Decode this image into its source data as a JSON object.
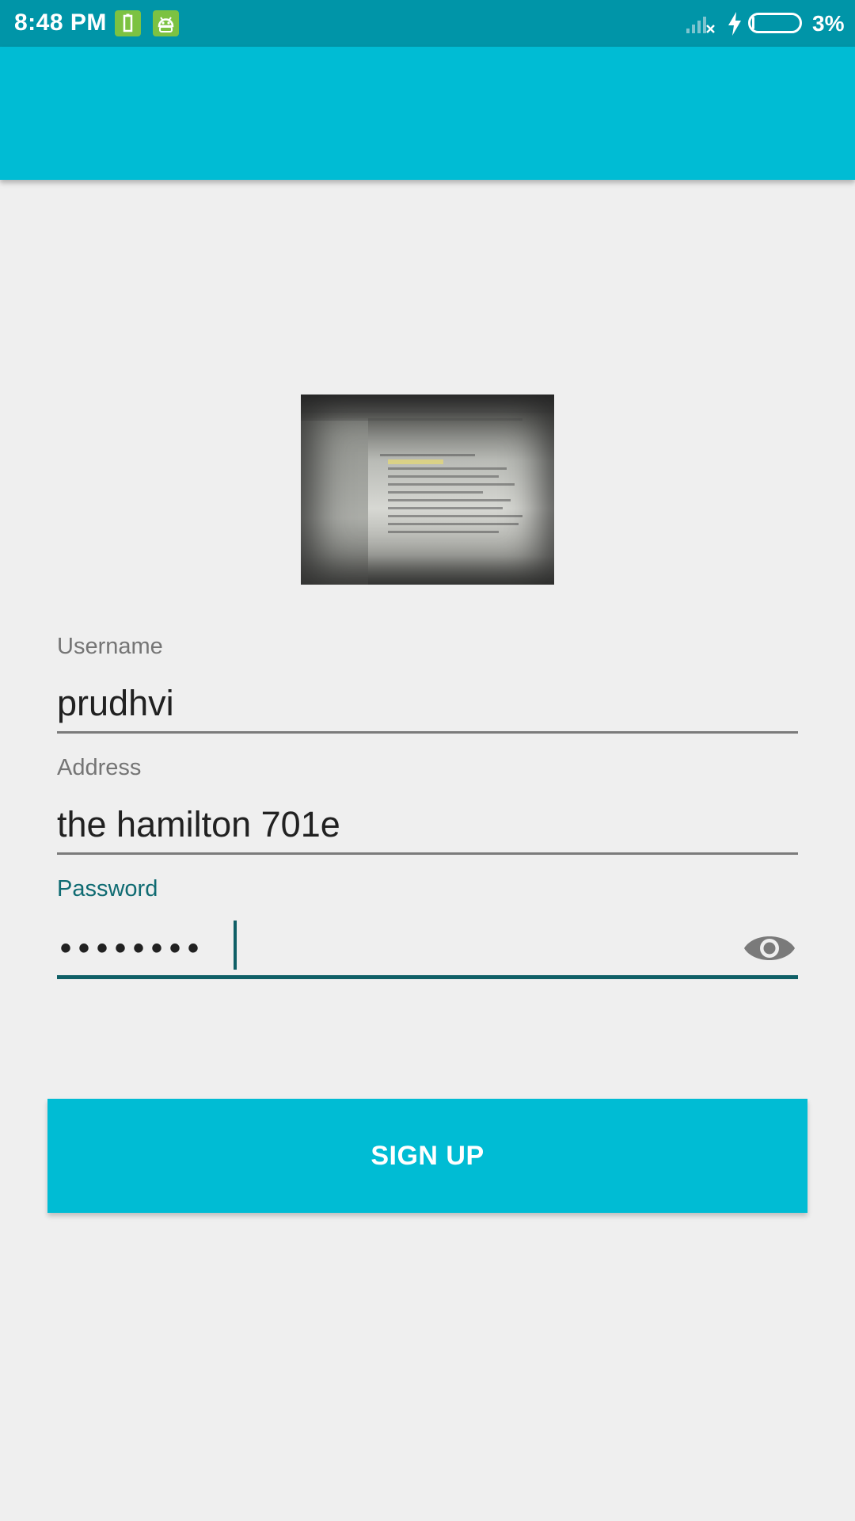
{
  "status_bar": {
    "time": "8:48 PM",
    "battery_percent": "3%",
    "icons": [
      "battery-saver-icon",
      "android-icon",
      "signal-off-icon",
      "charging-bolt-icon",
      "battery-icon"
    ]
  },
  "app_bar": {
    "title": ""
  },
  "form": {
    "username": {
      "label": "Username",
      "value": "prudhvi"
    },
    "address": {
      "label": "Address",
      "value": "the hamilton 701e"
    },
    "password": {
      "label": "Password",
      "masked_value": "••••••••",
      "toggle_icon": "eye-icon"
    }
  },
  "actions": {
    "signup_label": "SIGN UP"
  },
  "colors": {
    "status_bar": "#0095a8",
    "app_bar": "#00bcd4",
    "button": "#00bcd4",
    "accent": "#0f5f66",
    "background": "#efefef"
  }
}
